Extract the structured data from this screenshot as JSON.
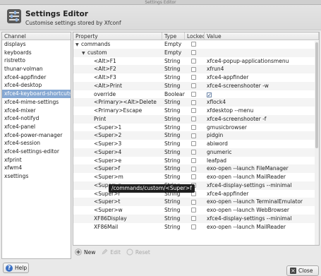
{
  "window": {
    "title": "Settings Editor"
  },
  "header": {
    "title": "Settings Editor",
    "subtitle": "Customise settings stored by Xfconf"
  },
  "channels": {
    "heading": "Channel",
    "items": [
      "displays",
      "keyboards",
      "ristretto",
      "thunar-volman",
      "xfce4-appfinder",
      "xfce4-desktop",
      "xfce4-keyboard-shortcuts",
      "xfce4-mime-settings",
      "xfce4-mixer",
      "xfce4-notifyd",
      "xfce4-panel",
      "xfce4-power-manager",
      "xfce4-session",
      "xfce4-settings-editor",
      "xfprint",
      "xfwm4",
      "xsettings"
    ],
    "selected_index": 6
  },
  "properties": {
    "headers": {
      "property": "Property",
      "type": "Type",
      "locked": "Locked",
      "value": "Value"
    },
    "rows": [
      {
        "indent": 0,
        "expander": "▼",
        "property": "commands",
        "type": "Empty",
        "value": ""
      },
      {
        "indent": 1,
        "expander": "▼",
        "property": "custom",
        "type": "Empty",
        "value": ""
      },
      {
        "indent": 2,
        "expander": "",
        "property": "<Alt>F1",
        "type": "String",
        "value": "xfce4-popup-applicationsmenu"
      },
      {
        "indent": 2,
        "expander": "",
        "property": "<Alt>F2",
        "type": "String",
        "value": "xfrun4"
      },
      {
        "indent": 2,
        "expander": "",
        "property": "<Alt>F3",
        "type": "String",
        "value": "xfce4-appfinder"
      },
      {
        "indent": 2,
        "expander": "",
        "property": "<Alt>Print",
        "type": "String",
        "value": "xfce4-screenshooter -w"
      },
      {
        "indent": 2,
        "expander": "",
        "property": "override",
        "type": "Boolean",
        "value": "",
        "bool": true
      },
      {
        "indent": 2,
        "expander": "",
        "property": "<Primary><Alt>Delete",
        "type": "String",
        "value": "xflock4"
      },
      {
        "indent": 2,
        "expander": "",
        "property": "<Primary>Escape",
        "type": "String",
        "value": "xfdesktop --menu"
      },
      {
        "indent": 2,
        "expander": "",
        "property": "Print",
        "type": "String",
        "value": "xfce4-screenshooter -f"
      },
      {
        "indent": 2,
        "expander": "",
        "property": "<Super>1",
        "type": "String",
        "value": "gmusicbrowser"
      },
      {
        "indent": 2,
        "expander": "",
        "property": "<Super>2",
        "type": "String",
        "value": "pidgin"
      },
      {
        "indent": 2,
        "expander": "",
        "property": "<Super>3",
        "type": "String",
        "value": "abiword"
      },
      {
        "indent": 2,
        "expander": "",
        "property": "<Super>4",
        "type": "String",
        "value": "gnumeric"
      },
      {
        "indent": 2,
        "expander": "",
        "property": "<Super>e",
        "type": "String",
        "value": "leafpad"
      },
      {
        "indent": 2,
        "expander": "",
        "property": "<Super>f",
        "type": "String",
        "value": "exo-open --launch FileManager"
      },
      {
        "indent": 2,
        "expander": "",
        "property": "<Super>m",
        "type": "String",
        "value": "exo-open --launch MailReader"
      },
      {
        "indent": 2,
        "expander": "",
        "property": "<Super>p",
        "type": "String",
        "value": "xfce4-display-settings --minimal"
      },
      {
        "indent": 2,
        "expander": "",
        "property": "<Super>r",
        "type": "String",
        "value": "xfce4-appfinder"
      },
      {
        "indent": 2,
        "expander": "",
        "property": "<Super>t",
        "type": "String",
        "value": "exo-open --launch TerminalEmulator"
      },
      {
        "indent": 2,
        "expander": "",
        "property": "<Super>w",
        "type": "String",
        "value": "exo-open --launch WebBrowser"
      },
      {
        "indent": 2,
        "expander": "",
        "property": "XF86Display",
        "type": "String",
        "value": "xfce4-display-settings --minimal"
      },
      {
        "indent": 2,
        "expander": "",
        "property": "XF86Mail",
        "type": "String",
        "value": "exo-open --launch MailReader"
      }
    ]
  },
  "tooltip": {
    "text": "/commands/custom/<Super>f"
  },
  "actions": {
    "new": "New",
    "edit": "Edit",
    "reset": "Reset"
  },
  "buttons": {
    "help": "Help",
    "close": "Close"
  },
  "colors": {
    "selection": "#86a8d3",
    "accent": "#3b70c4"
  }
}
